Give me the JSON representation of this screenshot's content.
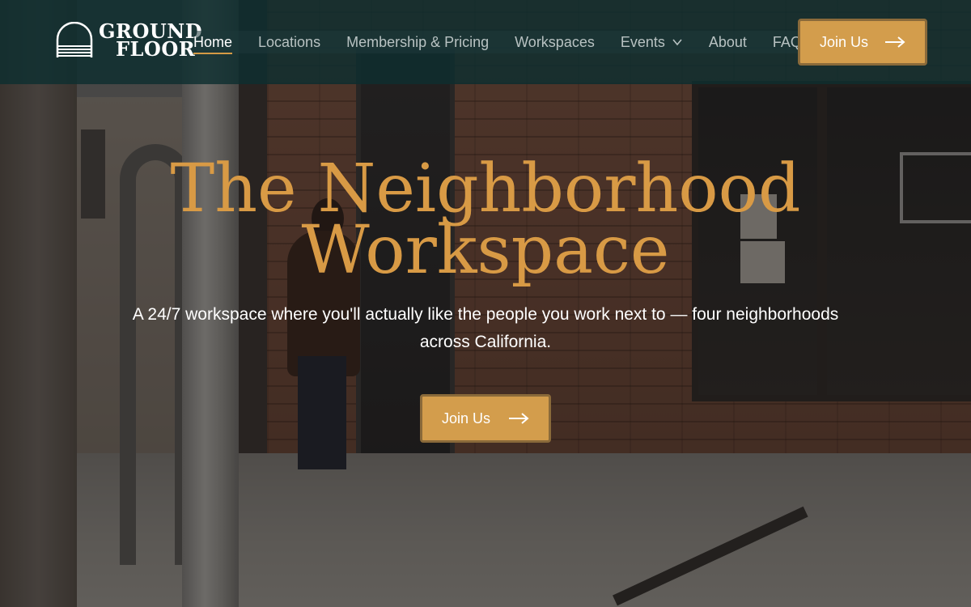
{
  "brand": {
    "logo_line1": "GROUND",
    "logo_line2": "FLOOR"
  },
  "nav": {
    "items": [
      {
        "label": "Home",
        "active": true
      },
      {
        "label": "Locations",
        "active": false
      },
      {
        "label": "Membership & Pricing",
        "active": false
      },
      {
        "label": "Workspaces",
        "active": false
      },
      {
        "label": "Events",
        "active": false,
        "has_dropdown": true
      },
      {
        "label": "About",
        "active": false
      },
      {
        "label": "FAQ",
        "active": false
      }
    ],
    "cta_label": "Join Us"
  },
  "hero": {
    "title_line1": "The Neighborhood",
    "title_line2": "Workspace",
    "subtitle": "A 24/7 workspace where you'll actually like the people you work next to — four neighborhoods across California.",
    "cta_label": "Join Us"
  },
  "colors": {
    "header_bg": "#0e2e30",
    "accent": "#d39d4c",
    "title": "#d89a45",
    "active_underline": "#d59a45"
  },
  "icons": {
    "logo": "arch-logo-icon",
    "dropdown": "chevron-down-icon",
    "cta_arrow": "arrow-right-icon"
  }
}
